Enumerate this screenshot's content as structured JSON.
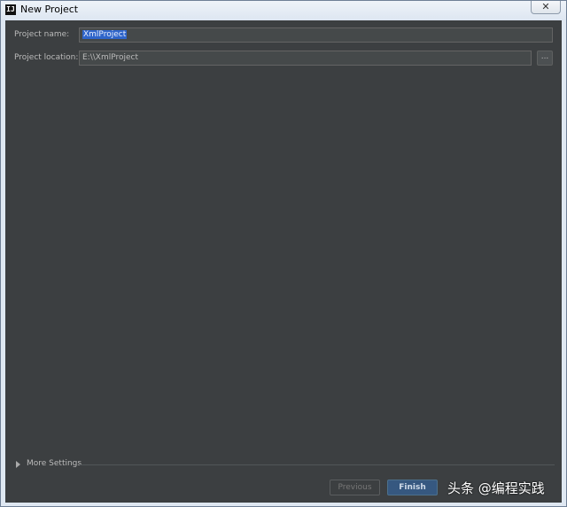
{
  "window": {
    "title": "New Project",
    "app_icon_glyph": "IJ",
    "close_glyph": "✕"
  },
  "form": {
    "project_name_label": "Project name:",
    "project_name_value": "XmlProject",
    "project_location_label": "Project location:",
    "project_location_value": "E:\\\\XmlProject",
    "browse_label": "..."
  },
  "more_settings": {
    "label": "More Settings"
  },
  "buttons": {
    "previous": "Previous",
    "finish": "Finish"
  },
  "watermark": "头条 @编程实践",
  "colors": {
    "panel_bg": "#3c3f41",
    "selection": "#2f65ca",
    "finish_bg": "#365880"
  }
}
